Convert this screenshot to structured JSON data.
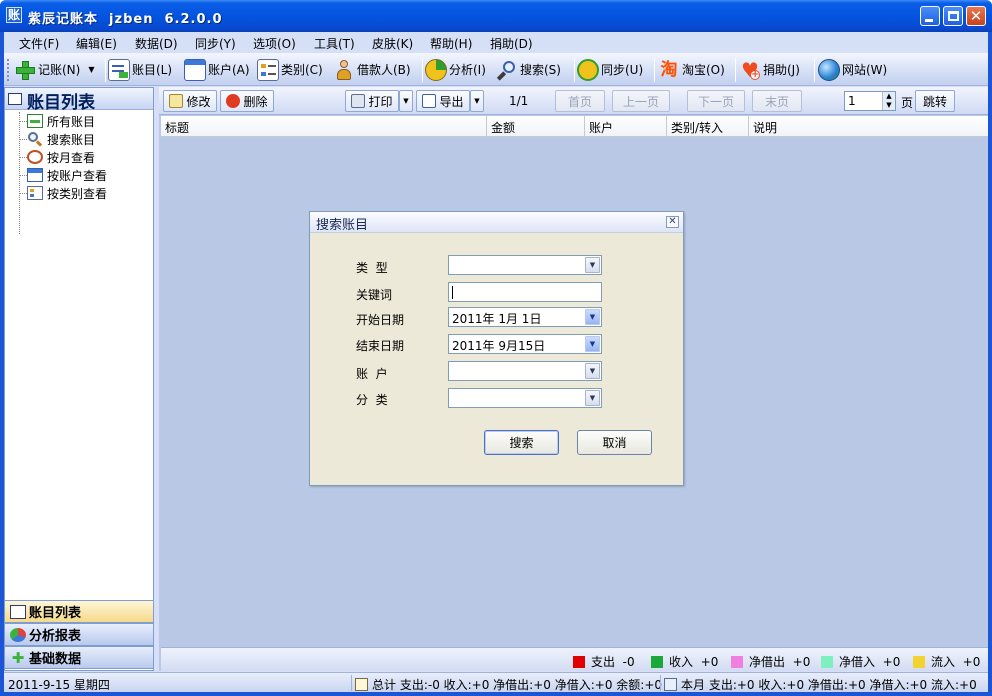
{
  "window": {
    "title": "紫辰记账本  jzben  6.2.0.0",
    "app_icon_char": "账"
  },
  "menu": [
    "文件(F)",
    "编辑(E)",
    "数据(D)",
    "同步(Y)",
    "选项(O)",
    "工具(T)",
    "皮肤(K)",
    "帮助(H)",
    "捐助(D)"
  ],
  "toolbar": {
    "record": "记账(N)",
    "accounts": "账目(L)",
    "account": "账户(A)",
    "category": "类别(C)",
    "borrower": "借款人(B)",
    "analysis": "分析(I)",
    "search": "搜索(S)",
    "sync": "同步(U)",
    "taobao": "淘宝(O)",
    "donate": "捐助(J)",
    "website": "网站(W)",
    "taobao_glyph": "淘"
  },
  "left_panel": {
    "header": "账目列表",
    "tree": [
      "所有账目",
      "搜索账目",
      "按月查看",
      "按账户查看",
      "按类别查看"
    ],
    "tabs": [
      "账目列表",
      "分析报表",
      "基础数据"
    ]
  },
  "list_toolbar": {
    "edit": "修改",
    "delete": "删除",
    "print": "打印",
    "export": "导出",
    "page_info": "1/1",
    "first": "首页",
    "prev": "上一页",
    "next": "下一页",
    "last": "末页",
    "page_value": "1",
    "page_unit": "页",
    "jump": "跳转"
  },
  "columns": [
    "标题",
    "金额",
    "账户",
    "类别/转入",
    "说明"
  ],
  "legend": [
    {
      "label": "支出",
      "value": "-0",
      "color": "#e00000"
    },
    {
      "label": "收入",
      "value": "+0",
      "color": "#1aa83a"
    },
    {
      "label": "净借出",
      "value": "+0",
      "color": "#f080e0"
    },
    {
      "label": "净借入",
      "value": "+0",
      "color": "#7ef0c0"
    },
    {
      "label": "流入",
      "value": "+0",
      "color": "#f3d233"
    }
  ],
  "statusbar": {
    "date": "2011-9-15 星期四",
    "total": "总计 支出:-0 收入:+0 净借出:+0 净借入:+0 余额:+0",
    "month": "本月 支出:+0 收入:+0 净借出:+0 净借入:+0 流入:+0"
  },
  "dialog": {
    "title": "搜索账目",
    "labels": {
      "type": "类  型",
      "keyword": "关键词",
      "start_date": "开始日期",
      "end_date": "结束日期",
      "account": "账  户",
      "category": "分  类"
    },
    "values": {
      "type": "",
      "keyword": "",
      "start_date": "2011年 1月 1日",
      "end_date": "2011年 9月15日",
      "account": "",
      "category": ""
    },
    "search_button": "搜索",
    "cancel_button": "取消"
  }
}
